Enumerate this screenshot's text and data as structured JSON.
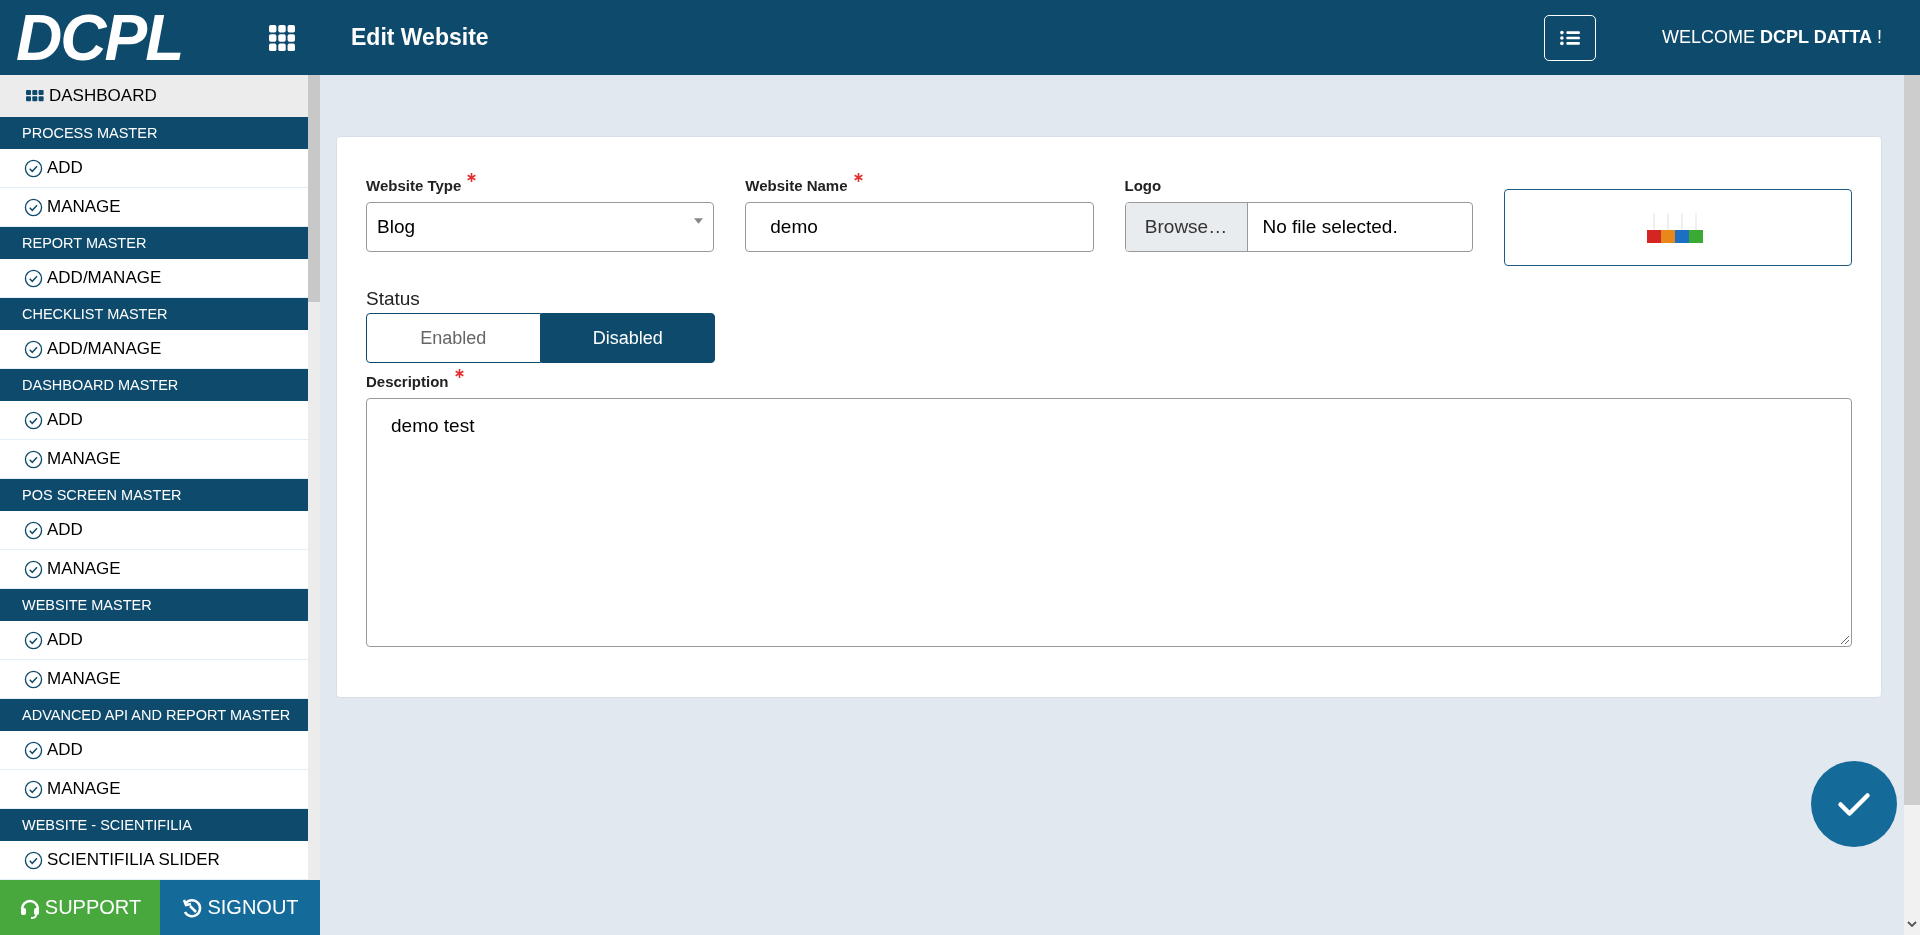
{
  "header": {
    "brand": "DCPL",
    "title": "Edit Website",
    "welcome": "WELCOME **DCPL DATTA** !"
  },
  "sidebar": {
    "dashboard": "DASHBOARD",
    "sections": [
      {
        "title": "PROCESS MASTER",
        "items": [
          "ADD",
          "MANAGE"
        ]
      },
      {
        "title": "REPORT MASTER",
        "items": [
          "ADD/MANAGE"
        ]
      },
      {
        "title": "CHECKLIST MASTER",
        "items": [
          "ADD/MANAGE"
        ]
      },
      {
        "title": "DASHBOARD MASTER",
        "items": [
          "ADD",
          "MANAGE"
        ]
      },
      {
        "title": "POS SCREEN MASTER",
        "items": [
          "ADD",
          "MANAGE"
        ]
      },
      {
        "title": "WEBSITE MASTER",
        "items": [
          "ADD",
          "MANAGE"
        ]
      },
      {
        "title": "ADVANCED API AND REPORT MASTER",
        "items": [
          "ADD",
          "MANAGE"
        ]
      },
      {
        "title": "WEBSITE - SCIENTIFILIA",
        "items": [
          "SCIENTIFILIA SLIDER"
        ]
      }
    ]
  },
  "footer_buttons": [
    {
      "label": "SUPPORT",
      "kind": "support"
    },
    {
      "label": "SIGNOUT",
      "kind": "signout"
    }
  ],
  "form": {
    "fields": [
      {
        "label": "Website Type",
        "required": true,
        "kind": "select",
        "value": "Blog"
      },
      {
        "label": "Website Name",
        "required": true,
        "kind": "text",
        "value": "demo"
      },
      {
        "label": "Logo",
        "required": false,
        "kind": "file",
        "button": "Browse…",
        "value": "No file selected."
      }
    ],
    "status": {
      "label": "Status",
      "options": [
        {
          "label": "Enabled",
          "selected": false
        },
        {
          "label": "Disabled",
          "selected": true
        }
      ]
    },
    "description": {
      "label": "Description",
      "required": true,
      "value": "demo test"
    }
  }
}
